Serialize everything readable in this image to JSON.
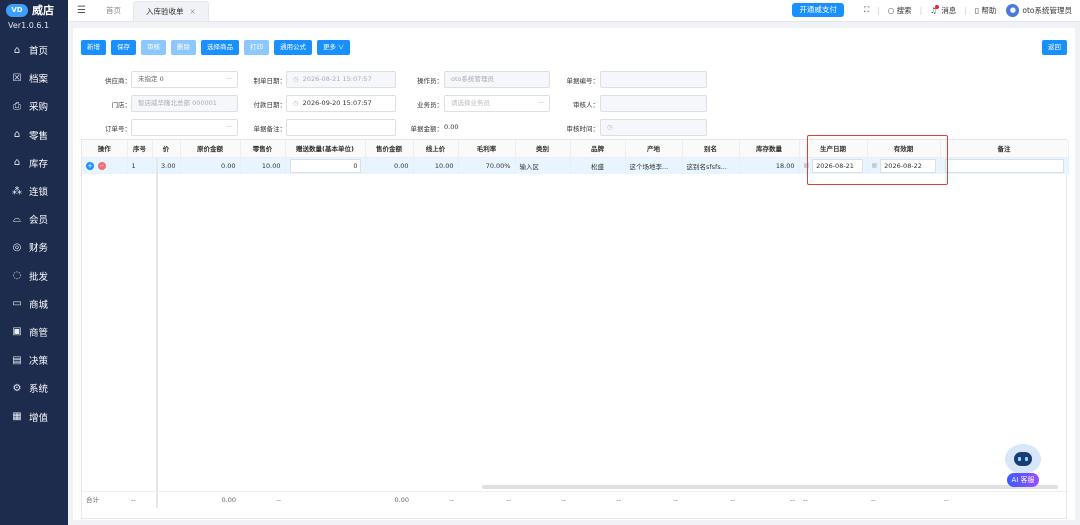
{
  "app": {
    "brand": "威店",
    "logo_text": "VD",
    "version": "Ver1.0.6.1"
  },
  "sidebar": {
    "items": [
      {
        "icon": "home-icon",
        "glyph": "⌂",
        "label": "首页"
      },
      {
        "icon": "archive-icon",
        "glyph": "☒",
        "label": "档案"
      },
      {
        "icon": "purchase-icon",
        "glyph": "⎙",
        "label": "采购"
      },
      {
        "icon": "retail-icon",
        "glyph": "⌂",
        "label": "零售"
      },
      {
        "icon": "warehouse-icon",
        "glyph": "⌂",
        "label": "库存"
      },
      {
        "icon": "chain-icon",
        "glyph": "⁂",
        "label": "连锁"
      },
      {
        "icon": "member-icon",
        "glyph": "⌓",
        "label": "会员"
      },
      {
        "icon": "finance-icon",
        "glyph": "◎",
        "label": "财务"
      },
      {
        "icon": "wholesale-icon",
        "glyph": "◌",
        "label": "批发"
      },
      {
        "icon": "mall-icon",
        "glyph": "▭",
        "label": "商城"
      },
      {
        "icon": "merchant-icon",
        "glyph": "▣",
        "label": "商管"
      },
      {
        "icon": "decision-icon",
        "glyph": "▤",
        "label": "决策"
      },
      {
        "icon": "system-icon",
        "glyph": "⚙",
        "label": "系统"
      },
      {
        "icon": "value-added-icon",
        "glyph": "▦",
        "label": "增值"
      }
    ]
  },
  "topbar": {
    "tabs": [
      {
        "label": "首页"
      },
      {
        "label": "入库验收单"
      }
    ],
    "pay_button": "开通威支付",
    "search": "搜索",
    "messages": "消息",
    "help": "帮助",
    "user": "oto系统管理员"
  },
  "toolbar": {
    "new": "新增",
    "save": "保存",
    "audit": "审核",
    "delete": "删除",
    "select_goods": "选择商品",
    "print": "打印",
    "apply_formula": "通用公式",
    "more": "更多 ∨",
    "return": "返回"
  },
  "form": {
    "supplier_label": "供应商：",
    "supplier_value": "未指定 0",
    "store_label": "门店：",
    "store_value": "智店威华隆北总部 000001",
    "order_no_label": "订单号：",
    "create_date_label": "制单日期：",
    "create_date_value": "2026-08-21 15:07:57",
    "pay_date_label": "付款日期：",
    "pay_date_value": "2026-09-20 15:07:57",
    "remark_label": "单据备注：",
    "operator_label": "操作员：",
    "operator_value": "oto系统管理员",
    "salesman_label": "业务员：",
    "salesman_placeholder": "请选择业务员",
    "amount_label": "单据金额：",
    "amount_value": "0.00",
    "doc_no_label": "单据编号：",
    "auditor_label": "审核人：",
    "audit_time_label": "审核时间："
  },
  "table": {
    "columns": [
      "操作",
      "序号",
      "价",
      "原价金额",
      "零售价",
      "赠送数量(基本单位)",
      "售价金额",
      "线上价",
      "毛利率",
      "类别",
      "品牌",
      "产地",
      "别名",
      "库存数量",
      "生产日期",
      "有效期",
      "备注"
    ],
    "row": {
      "seq": "1",
      "price": "3.00",
      "orig_amount": "0.00",
      "retail": "10.00",
      "gift_qty": "0",
      "sale_amount": "0.00",
      "online": "10.00",
      "margin": "70.00%",
      "category": "输入区",
      "brand": "松盛",
      "origin": "这个场地李...",
      "alias": "这别名sfsfs...",
      "stock": "18.00",
      "prod_date": "2026-08-21",
      "expiry": "2026-08-22"
    },
    "footer": {
      "label": "合计",
      "dash": "--",
      "orig_total": "0.00",
      "sale_total": "0.00"
    }
  },
  "ai": {
    "label": "AI 客服"
  }
}
